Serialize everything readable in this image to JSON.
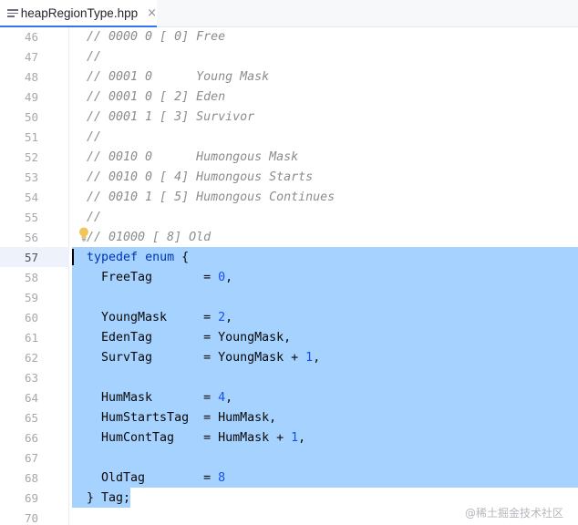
{
  "tab": {
    "title": "heapRegionType.hpp",
    "close_glyph": "×"
  },
  "lines": [
    {
      "n": "46",
      "segments": [
        {
          "t": "// 0000 0 [ 0] Free",
          "c": "cm"
        }
      ]
    },
    {
      "n": "47",
      "segments": [
        {
          "t": "//",
          "c": "cm"
        }
      ]
    },
    {
      "n": "48",
      "segments": [
        {
          "t": "// 0001 0      Young Mask",
          "c": "cm"
        }
      ]
    },
    {
      "n": "49",
      "segments": [
        {
          "t": "// 0001 0 [ 2] Eden",
          "c": "cm"
        }
      ]
    },
    {
      "n": "50",
      "segments": [
        {
          "t": "// 0001 1 [ 3] Survivor",
          "c": "cm"
        }
      ]
    },
    {
      "n": "51",
      "segments": [
        {
          "t": "//",
          "c": "cm"
        }
      ]
    },
    {
      "n": "52",
      "segments": [
        {
          "t": "// 0010 0      Humongous Mask",
          "c": "cm"
        }
      ]
    },
    {
      "n": "53",
      "segments": [
        {
          "t": "// 0010 0 [ 4] Humongous Starts",
          "c": "cm"
        }
      ]
    },
    {
      "n": "54",
      "segments": [
        {
          "t": "// 0010 1 [ 5] Humongous Continues",
          "c": "cm"
        }
      ]
    },
    {
      "n": "55",
      "segments": [
        {
          "t": "//",
          "c": "cm"
        }
      ]
    },
    {
      "n": "56",
      "segments": [
        {
          "t": "// 01000 [ 8] Old",
          "c": "cm"
        }
      ]
    },
    {
      "n": "57",
      "active": true,
      "segments": [
        {
          "t": "typedef",
          "c": "kw"
        },
        {
          "t": " "
        },
        {
          "t": "enum",
          "c": "kw"
        },
        {
          "t": " {"
        }
      ]
    },
    {
      "n": "58",
      "segments": [
        {
          "t": "  FreeTag       = "
        },
        {
          "t": "0",
          "c": "num"
        },
        {
          "t": ","
        }
      ]
    },
    {
      "n": "59",
      "segments": []
    },
    {
      "n": "60",
      "segments": [
        {
          "t": "  YoungMask     = "
        },
        {
          "t": "2",
          "c": "num"
        },
        {
          "t": ","
        }
      ]
    },
    {
      "n": "61",
      "segments": [
        {
          "t": "  EdenTag       = YoungMask,"
        }
      ]
    },
    {
      "n": "62",
      "segments": [
        {
          "t": "  SurvTag       = YoungMask + "
        },
        {
          "t": "1",
          "c": "num"
        },
        {
          "t": ","
        }
      ]
    },
    {
      "n": "63",
      "segments": []
    },
    {
      "n": "64",
      "segments": [
        {
          "t": "  HumMask       = "
        },
        {
          "t": "4",
          "c": "num"
        },
        {
          "t": ","
        }
      ]
    },
    {
      "n": "65",
      "segments": [
        {
          "t": "  HumStartsTag  = HumMask,"
        }
      ]
    },
    {
      "n": "66",
      "segments": [
        {
          "t": "  HumContTag    = HumMask + "
        },
        {
          "t": "1",
          "c": "num"
        },
        {
          "t": ","
        }
      ]
    },
    {
      "n": "67",
      "segments": []
    },
    {
      "n": "68",
      "segments": [
        {
          "t": "  OldTag        = "
        },
        {
          "t": "8",
          "c": "num"
        }
      ]
    },
    {
      "n": "69",
      "segments": [
        {
          "t": "} Tag;"
        }
      ]
    },
    {
      "n": "70",
      "segments": []
    }
  ],
  "watermark": "@稀土掘金技术社区",
  "colors": {
    "selection": "#a6d2ff",
    "keyword": "#0033b3",
    "number": "#1750eb",
    "comment": "#8c8c8c",
    "tab_underline": "#3574f0"
  }
}
